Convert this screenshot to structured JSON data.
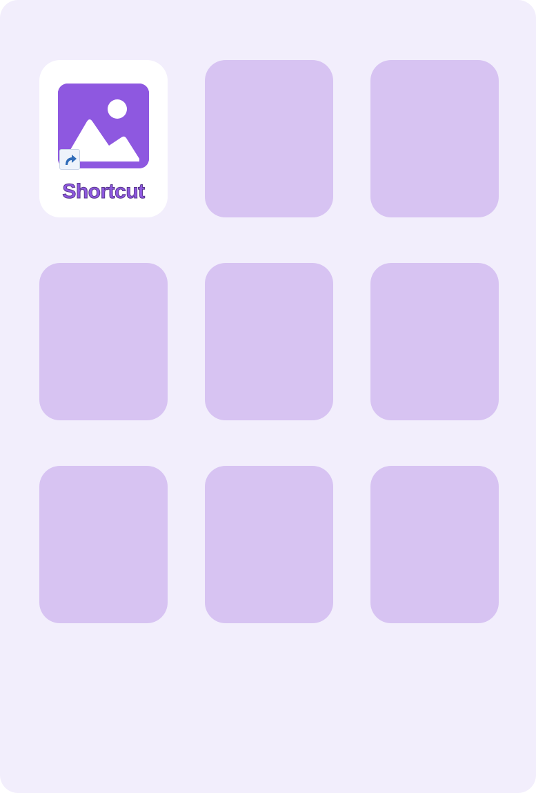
{
  "launcher": {
    "tiles": [
      {
        "label": "Shortcut",
        "icon": "image-gallery-icon",
        "badge": "shortcut-arrow-icon",
        "active": true
      },
      {
        "label": "",
        "active": false
      },
      {
        "label": "",
        "active": false
      },
      {
        "label": "",
        "active": false
      },
      {
        "label": "",
        "active": false
      },
      {
        "label": "",
        "active": false
      },
      {
        "label": "",
        "active": false
      },
      {
        "label": "",
        "active": false
      },
      {
        "label": "",
        "active": false
      }
    ]
  },
  "colors": {
    "background": "#f2eefc",
    "tile_placeholder": "#d7c3f2",
    "tile_active": "#ffffff",
    "accent": "#8e58e0",
    "shortcut_arrow": "#2f6bb8"
  }
}
